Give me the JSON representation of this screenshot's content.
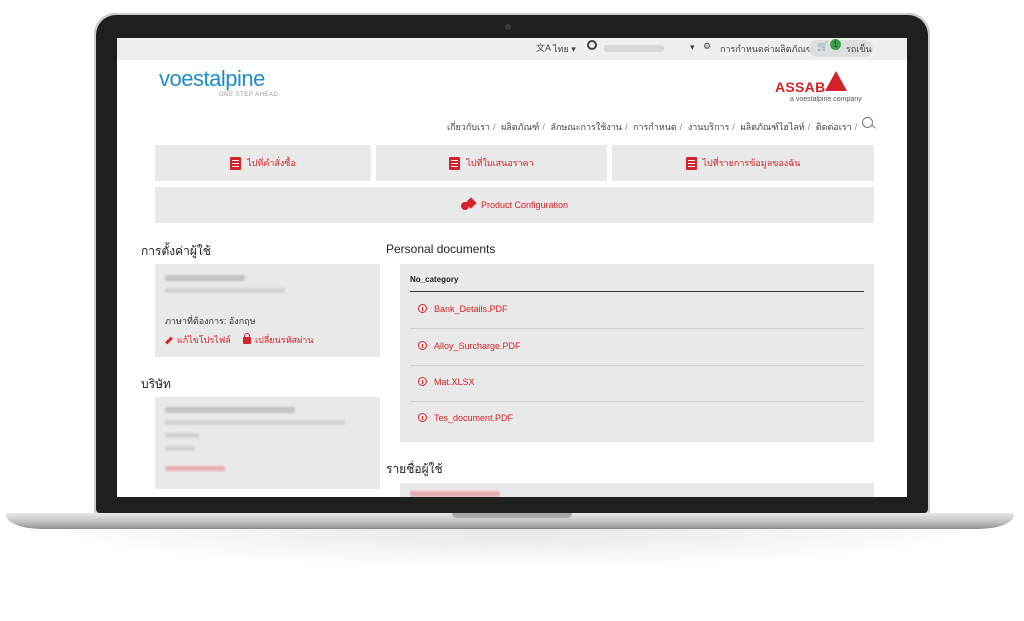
{
  "topbar": {
    "lang_icon": "translate-icon",
    "language": "ไทย ▾",
    "user_caret": "▾",
    "config_label": "การกำหนดค่าผลิตภัณฑ์",
    "cart_count": "1",
    "cart_label": "รถเข็น"
  },
  "brand": {
    "logo": "voestalpine",
    "tagline": "ONE STEP AHEAD.",
    "partner": "ASSAB",
    "partner_sub": "a voestalpine company",
    "accent": "#d2232a",
    "logo_color": "#1f8ec6"
  },
  "nav": {
    "items": [
      "เกี่ยวกับเรา",
      "ผลิตภัณฑ์",
      "ลักษณะการใช้งาน",
      "การกำหนด",
      "งานบริการ",
      "ผลิตภัณฑ์ไฮไลท์",
      "ติดต่อเรา"
    ]
  },
  "tiles": {
    "orders": "ไปที่คำสั่งซื้อ",
    "quotes": "ไปที่ใบเสนอราคา",
    "favorites": "ไปที่รายการข้อมูลของฉัน",
    "product_config": "Product Configuration"
  },
  "user_settings": {
    "title": "การตั้งค่าผู้ใช้",
    "language_line": "ภาษาที่ต้องการ: อังกฤษ",
    "edit_profile": "แก้ไขโปรไฟล์",
    "change_password": "เปลี่ยนรหัสผ่าน"
  },
  "company": {
    "title": "บริษัท"
  },
  "documents": {
    "title": "Personal documents",
    "category": "No_category",
    "files": [
      "Bank_Details.PDF",
      "Alloy_Surcharge.PDF",
      "Mat.XLSX",
      "Tes_document.PDF"
    ]
  },
  "user_list": {
    "title": "รายชื่อผู้ใช้"
  }
}
